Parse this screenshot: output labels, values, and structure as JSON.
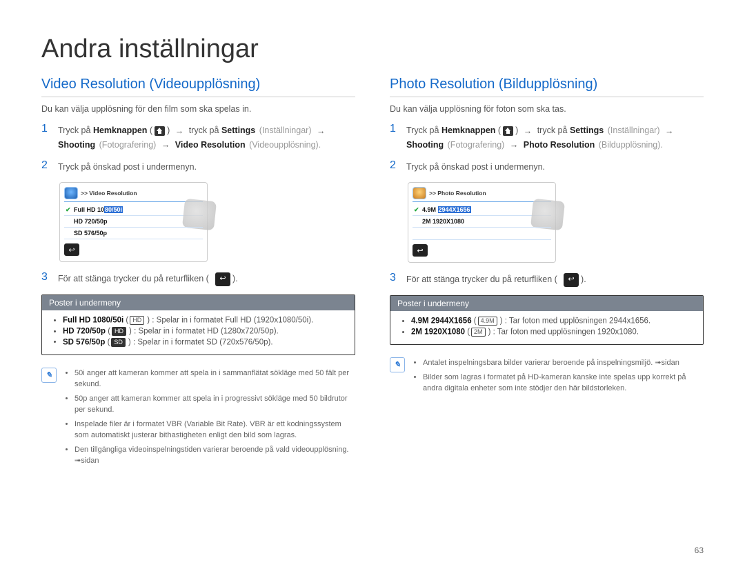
{
  "page": {
    "title": "Andra inställningar",
    "number": "63"
  },
  "left": {
    "heading": "Video Resolution (Videoupplösning)",
    "intro": "Du kan välja upplösning för den film som ska spelas in.",
    "step1": {
      "prefix": "Tryck på ",
      "home_bold": "Hemknappen",
      "mid1": " tryck på ",
      "settings_bold": "Settings",
      "settings_light": "(Inställningar)",
      "shooting_bold": "Shooting",
      "shooting_light": "(Fotografering)",
      "target_bold": "Video Resolution",
      "target_light": "(Videoupplösning)."
    },
    "step2": "Tryck på önskad post i undermenyn.",
    "screenshot": {
      "title": ">> Video Resolution",
      "row1_a": "Full HD 10",
      "row1_b": "80/50i",
      "row2": "HD  720/50p",
      "row3": "SD  576/50p"
    },
    "step3": "För att stänga trycker du på returfliken (",
    "step3_end": ").",
    "submenu": {
      "title": "Poster i undermeny",
      "items": [
        {
          "bold": "Full HD 1080/50i",
          "tag": "HD",
          "tagInv": false,
          "desc": ": Spelar in i formatet Full HD (1920x1080/50i)."
        },
        {
          "bold": "HD 720/50p",
          "tag": "HD",
          "tagInv": true,
          "desc": ": Spelar in i formatet HD (1280x720/50p)."
        },
        {
          "bold": "SD 576/50p",
          "tag": "SD",
          "tagInv": true,
          "desc": ": Spelar in i formatet SD (720x576/50p)."
        }
      ]
    },
    "notes": [
      "50i anger att kameran kommer att spela in i sammanflätat sökläge med 50 fält per sekund.",
      "50p anger att kameran kommer att spela in i progressivt sökläge med 50 bildrutor per sekund.",
      "Inspelade filer är i formatet VBR (Variable Bit Rate). VBR är ett kodningssystem som automatiskt justerar bithastigheten enligt den bild som lagras.",
      "Den tillgängliga videoinspelningstiden varierar beroende på vald videoupplösning. ➟sidan"
    ]
  },
  "right": {
    "heading": "Photo Resolution (Bildupplösning)",
    "intro": "Du kan välja upplösning för foton som ska tas.",
    "step1": {
      "prefix": "Tryck på ",
      "home_bold": "Hemknappen",
      "mid1": " tryck på ",
      "settings_bold": "Settings",
      "settings_light": "(Inställningar)",
      "shooting_bold": "Shooting",
      "shooting_light": "(Fotografering)",
      "target_bold": "Photo Resolution",
      "target_light": "(Bildupplösning)."
    },
    "step2": "Tryck på önskad post i undermenyn.",
    "screenshot": {
      "title": ">> Photo Resolution",
      "row1_a": "4.9M  ",
      "row1_b": "2944X1656",
      "row2": "2M   1920X1080"
    },
    "step3": "För att stänga trycker du på returfliken (",
    "step3_end": ").",
    "submenu": {
      "title": "Poster i undermeny",
      "items": [
        {
          "bold": "4.9M 2944X1656",
          "tag": "4.9M",
          "tagInv": false,
          "desc": ": Tar foton med upplösningen 2944x1656."
        },
        {
          "bold": "2M 1920X1080",
          "tag": "2M",
          "tagInv": false,
          "desc": ": Tar foton med upplösningen 1920x1080."
        }
      ]
    },
    "notes": [
      "Antalet inspelningsbara bilder varierar beroende på inspelningsmiljö. ➟sidan",
      "Bilder som lagras i formatet på HD-kameran kanske inte spelas upp korrekt på andra digitala enheter som inte stödjer den här bildstorleken."
    ]
  }
}
